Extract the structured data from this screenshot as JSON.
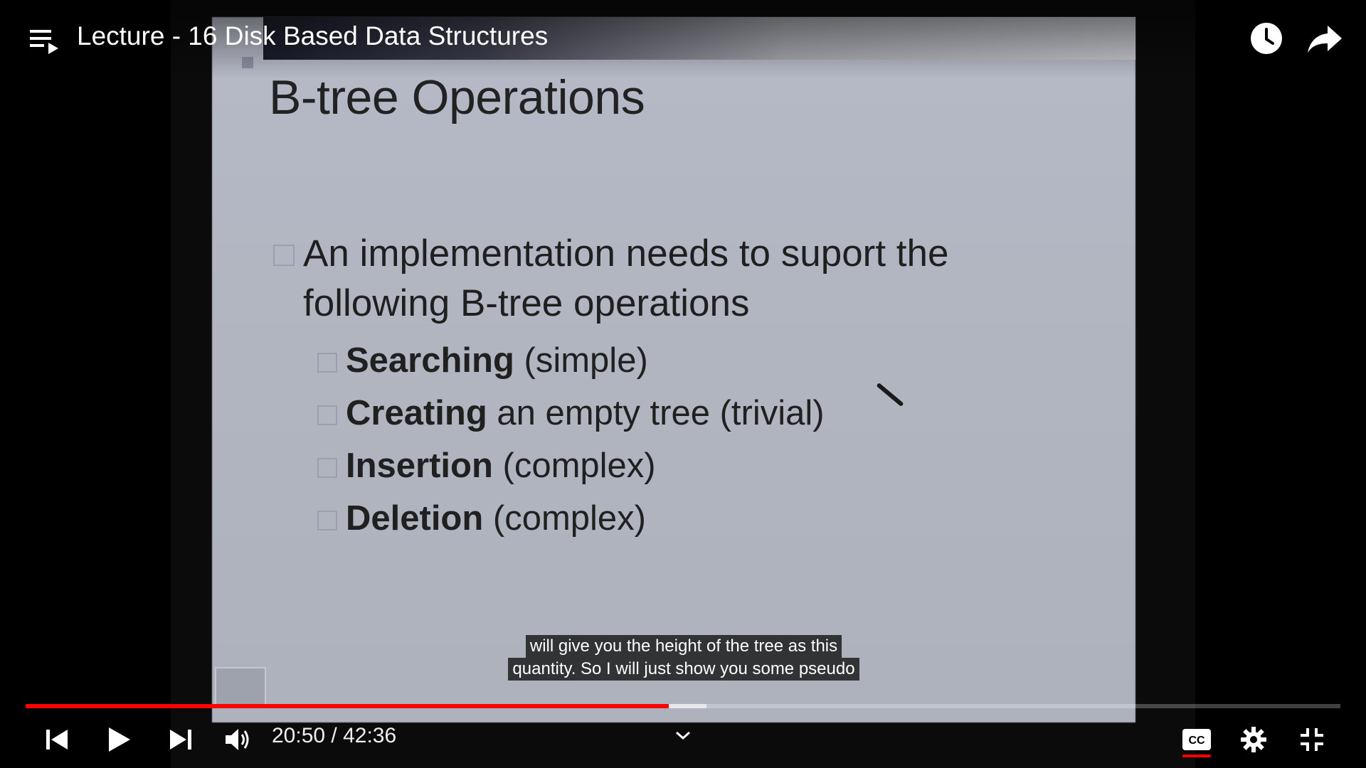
{
  "video": {
    "title": "Lecture - 16 Disk Based Data Structures",
    "current_time": "20:50",
    "duration": "42:36",
    "time_separator": " / ",
    "progress_fraction": 0.489,
    "buffered_fraction": 0.518
  },
  "slide": {
    "title": "B-tree Operations",
    "main_bullet_line1": "An implementation needs to suport the",
    "main_bullet_line2": "following B-tree operations",
    "items": [
      {
        "bold": "Searching",
        "rest": " (simple)"
      },
      {
        "bold": "Creating",
        "rest": " an empty tree (trivial)"
      },
      {
        "bold": "Insertion",
        "rest": " (complex)"
      },
      {
        "bold": "Deletion",
        "rest": " (complex)"
      }
    ]
  },
  "captions": {
    "line1": "will give you the height of the tree as this",
    "line2": "quantity. So I will just show you some pseudo"
  },
  "icons": {
    "playlist": "playlist-icon",
    "watch_later": "clock-icon",
    "share": "share-icon",
    "previous": "skip-previous-icon",
    "play": "play-icon",
    "next": "skip-next-icon",
    "volume": "volume-icon",
    "chevron": "chevron-down-icon",
    "captions": "cc-icon",
    "settings": "gear-icon",
    "exit_fullscreen": "exit-fullscreen-icon"
  },
  "colors": {
    "progress_played": "#ff0000",
    "cc_active": "#ff0000"
  }
}
